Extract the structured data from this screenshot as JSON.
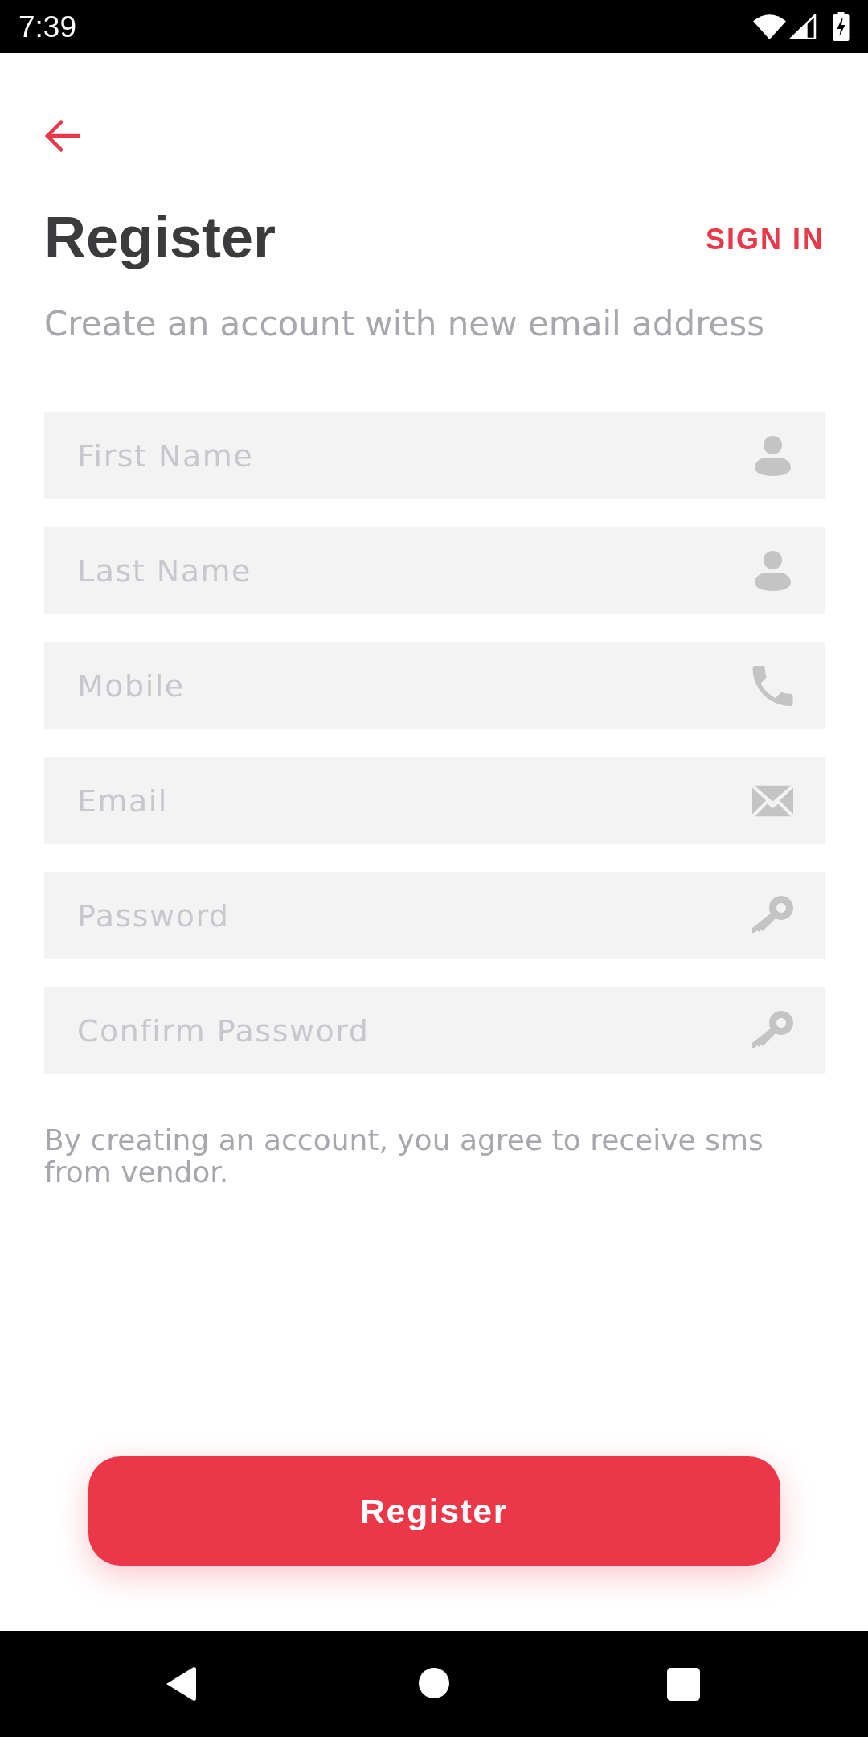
{
  "status_bar": {
    "time": "7:39"
  },
  "header": {
    "title": "Register",
    "sign_in_link": "SIGN IN",
    "subtitle": "Create an account with new email address"
  },
  "fields": [
    {
      "kind": "name",
      "placeholder": "First Name"
    },
    {
      "kind": "name",
      "placeholder": "Last Name"
    },
    {
      "kind": "phone",
      "placeholder": "Mobile"
    },
    {
      "kind": "email",
      "placeholder": "Email"
    },
    {
      "kind": "password",
      "placeholder": "Password"
    },
    {
      "kind": "password",
      "placeholder": "Confirm Password"
    }
  ],
  "notice": "By creating an account, you agree to receive sms from vendor.",
  "submit_button": "Register"
}
